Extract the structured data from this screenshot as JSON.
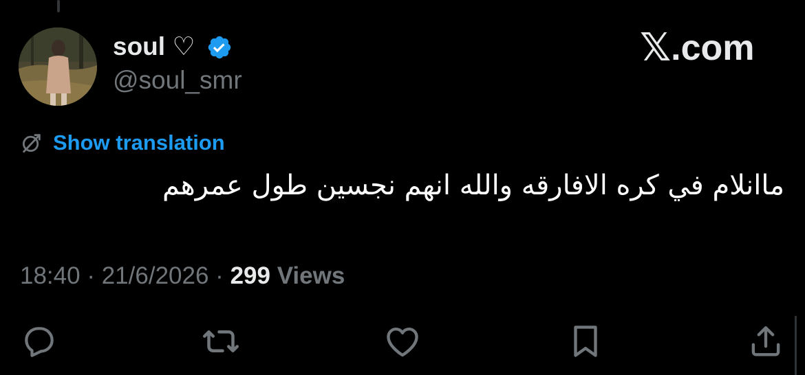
{
  "author": {
    "display_name": "soul ♡",
    "handle": "@soul_smr",
    "verified": true
  },
  "brand": {
    "x_glyph": "𝕏",
    "domain": ".com"
  },
  "translation": {
    "label": "Show translation"
  },
  "tweet": {
    "text": "ماانلام في كره الافارقه والله انهم نجسين طول عمرهم"
  },
  "meta": {
    "time": "18:40",
    "separator": "·",
    "date": "21/6/2026",
    "views_count": "299",
    "views_label": "Views"
  },
  "colors": {
    "background": "#000000",
    "text": "#e7e9ea",
    "muted": "#71767b",
    "accent": "#1d9bf0"
  },
  "icons": {
    "reply": "reply-icon",
    "retweet": "retweet-icon",
    "like": "like-icon",
    "bookmark": "bookmark-icon",
    "share": "share-icon",
    "translate": "translate-icon",
    "verified": "verified-badge-icon"
  }
}
